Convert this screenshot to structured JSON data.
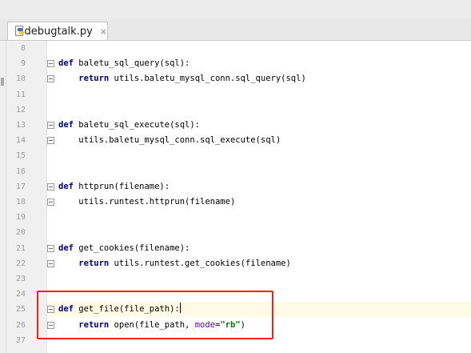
{
  "tab": {
    "filename": "debugtalk.py",
    "close": "×",
    "icon": "python-file-icon"
  },
  "editor": {
    "lines": [
      {
        "num": "8",
        "fold": "",
        "indent": "",
        "tokens": []
      },
      {
        "num": "9",
        "fold": "open",
        "indent": "",
        "tokens": [
          {
            "t": "def",
            "c": "kw"
          },
          {
            "t": " baletu_sql_query(sql):",
            "c": ""
          }
        ]
      },
      {
        "num": "10",
        "fold": "end",
        "indent": "    ",
        "tokens": [
          {
            "t": "return",
            "c": "kw"
          },
          {
            "t": " utils.baletu_mysql_conn.sql_query(sql)",
            "c": ""
          }
        ]
      },
      {
        "num": "11",
        "fold": "",
        "indent": "",
        "tokens": []
      },
      {
        "num": "12",
        "fold": "",
        "indent": "",
        "tokens": []
      },
      {
        "num": "13",
        "fold": "open",
        "indent": "",
        "tokens": [
          {
            "t": "def",
            "c": "kw"
          },
          {
            "t": " baletu_sql_execute(sql):",
            "c": ""
          }
        ]
      },
      {
        "num": "14",
        "fold": "end",
        "indent": "    ",
        "tokens": [
          {
            "t": "utils.baletu_mysql_conn.sql_execute(sql)",
            "c": ""
          }
        ]
      },
      {
        "num": "15",
        "fold": "",
        "indent": "",
        "tokens": []
      },
      {
        "num": "16",
        "fold": "",
        "indent": "",
        "tokens": []
      },
      {
        "num": "17",
        "fold": "open",
        "indent": "",
        "tokens": [
          {
            "t": "def",
            "c": "kw"
          },
          {
            "t": " httprun(filename):",
            "c": ""
          }
        ]
      },
      {
        "num": "18",
        "fold": "end",
        "indent": "    ",
        "tokens": [
          {
            "t": "utils.runtest.httprun(filename)",
            "c": ""
          }
        ]
      },
      {
        "num": "19",
        "fold": "",
        "indent": "",
        "tokens": []
      },
      {
        "num": "20",
        "fold": "",
        "indent": "",
        "tokens": []
      },
      {
        "num": "21",
        "fold": "open",
        "indent": "",
        "tokens": [
          {
            "t": "def",
            "c": "kw"
          },
          {
            "t": " get_cookies(filename):",
            "c": ""
          }
        ]
      },
      {
        "num": "22",
        "fold": "end",
        "indent": "    ",
        "tokens": [
          {
            "t": "return",
            "c": "kw"
          },
          {
            "t": " utils.runtest.get_cookies(filename)",
            "c": ""
          }
        ]
      },
      {
        "num": "23",
        "fold": "",
        "indent": "",
        "tokens": []
      },
      {
        "num": "24",
        "fold": "",
        "indent": "",
        "tokens": []
      },
      {
        "num": "25",
        "fold": "open",
        "indent": "",
        "current": true,
        "caret": true,
        "tokens": [
          {
            "t": "def",
            "c": "kw"
          },
          {
            "t": " get_file(file_path):",
            "c": ""
          }
        ]
      },
      {
        "num": "26",
        "fold": "end",
        "indent": "    ",
        "tokens": [
          {
            "t": "return",
            "c": "kw"
          },
          {
            "t": " open(file_path, ",
            "c": ""
          },
          {
            "t": "mode",
            "c": "param"
          },
          {
            "t": "=",
            "c": ""
          },
          {
            "t": "\"rb\"",
            "c": "str"
          },
          {
            "t": ")",
            "c": ""
          }
        ]
      },
      {
        "num": "27",
        "fold": "",
        "indent": "",
        "tokens": []
      }
    ]
  },
  "annotation": {
    "color": "#f0221a"
  }
}
